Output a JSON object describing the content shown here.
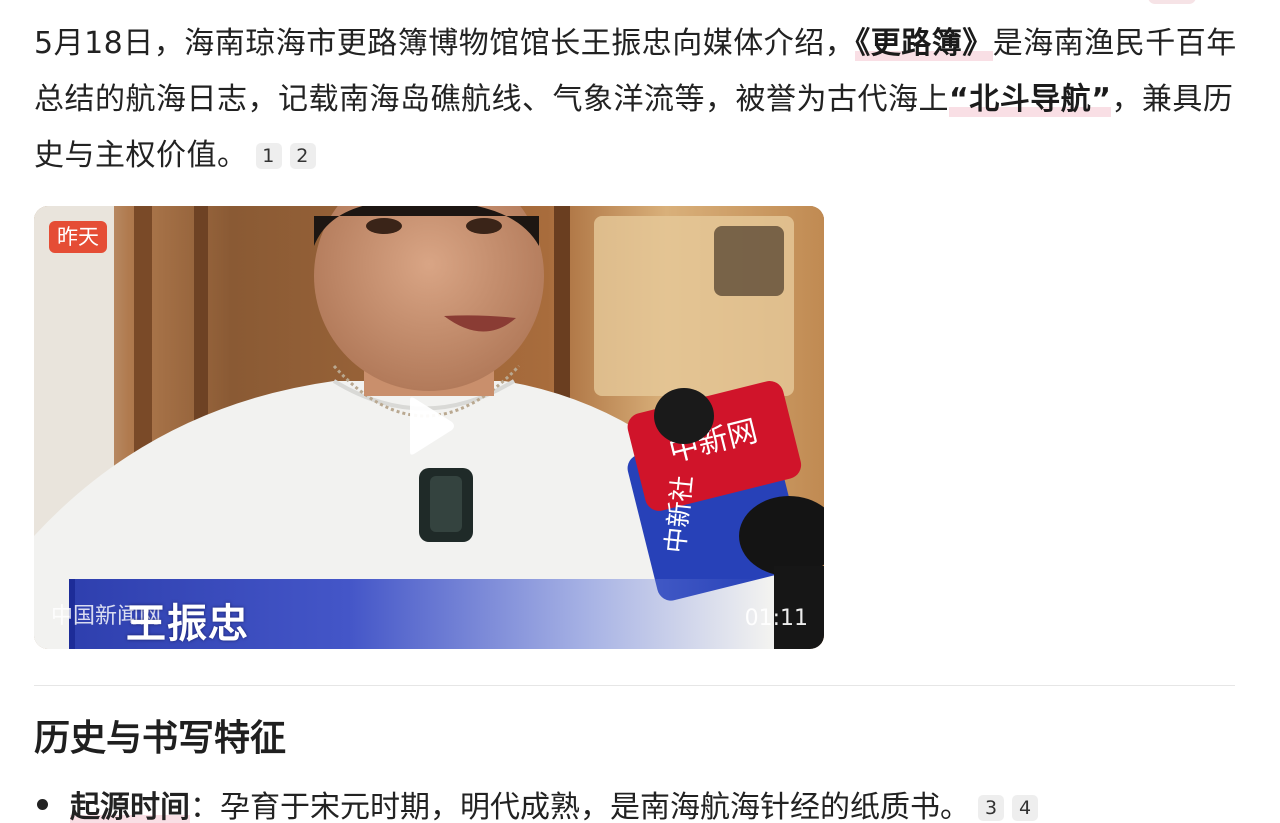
{
  "article": {
    "intro": {
      "p1": "5月18日，海南琼海市更路簿博物馆馆长王振忠向媒体介绍，",
      "hl1": "《更路簿》",
      "p2": "是海南渔民千百年总结的航海日志，记载南海岛礁航线、气象洋流等，被誉为古代海上",
      "hl2": "“北斗导航”",
      "p3": "，兼具历史与主权价值。",
      "citations": [
        "1",
        "2"
      ]
    },
    "video": {
      "badge": "昨天",
      "source": "中国新闻网",
      "caption_name": "王振忠",
      "duration": "01:11",
      "icons": [
        "play-icon"
      ]
    },
    "section": {
      "title": "历史与书写特征",
      "bullets": [
        {
          "term": "起源时间",
          "text": "：孕育于宋元时期，明代成熟，是南海航海针经的纸质书。",
          "citations": [
            "3",
            "4"
          ]
        }
      ]
    }
  },
  "colors": {
    "highlight": "#f9dfe5",
    "badge": "#e54d35",
    "lower_third": "#2e3fae"
  }
}
